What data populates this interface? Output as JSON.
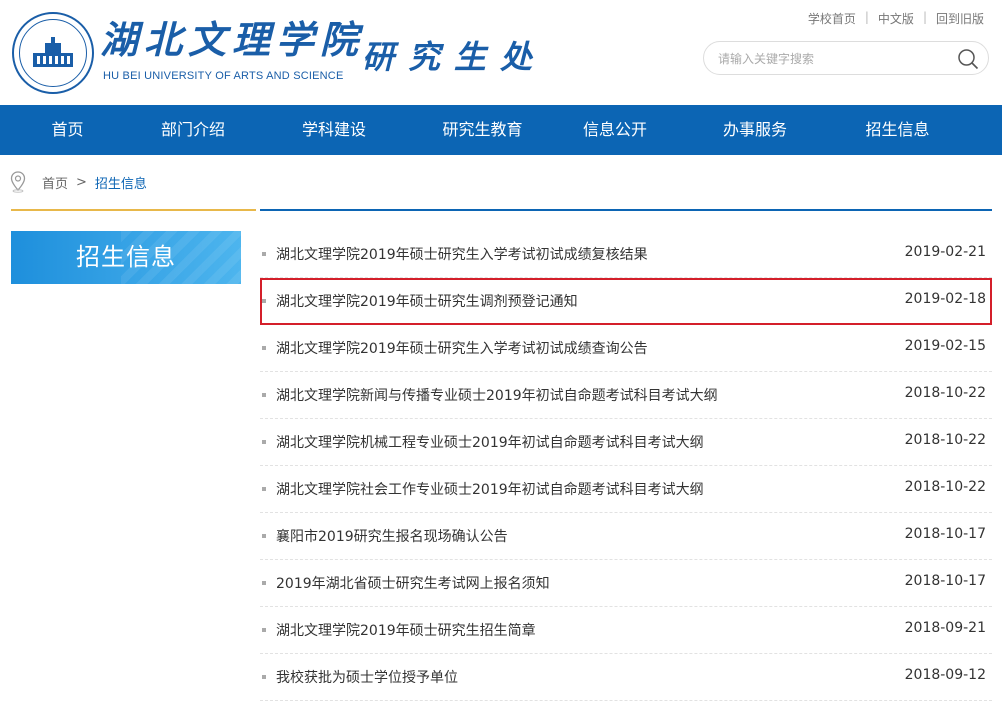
{
  "header": {
    "school_name": "湖北文理学院",
    "school_name_en": "HU BEI UNIVERSITY OF ARTS AND SCIENCE",
    "dept_name": "研究生处",
    "top_links": [
      "学校首页",
      "中文版",
      "回到旧版"
    ],
    "search_placeholder": "请输入关键字搜索",
    "brand_color": "#0c65b4"
  },
  "nav": {
    "items": [
      "首页",
      "部门介绍",
      "学科建设",
      "研究生教育",
      "信息公开",
      "办事服务",
      "招生信息"
    ]
  },
  "breadcrumb": {
    "home": "首页",
    "separator": ">",
    "current": "招生信息"
  },
  "sidebar": {
    "title": "招生信息"
  },
  "news": {
    "highlight_color": "#d41f2a",
    "items": [
      {
        "title": "湖北文理学院2019年硕士研究生入学考试初试成绩复核结果",
        "date": "2019-02-21",
        "highlighted": false
      },
      {
        "title": "湖北文理学院2019年硕士研究生调剂预登记通知",
        "date": "2019-02-18",
        "highlighted": true
      },
      {
        "title": "湖北文理学院2019年硕士研究生入学考试初试成绩查询公告",
        "date": "2019-02-15",
        "highlighted": false
      },
      {
        "title": "湖北文理学院新闻与传播专业硕士2019年初试自命题考试科目考试大纲",
        "date": "2018-10-22",
        "highlighted": false
      },
      {
        "title": "湖北文理学院机械工程专业硕士2019年初试自命题考试科目考试大纲",
        "date": "2018-10-22",
        "highlighted": false
      },
      {
        "title": "湖北文理学院社会工作专业硕士2019年初试自命题考试科目考试大纲",
        "date": "2018-10-22",
        "highlighted": false
      },
      {
        "title": "襄阳市2019研究生报名现场确认公告",
        "date": "2018-10-17",
        "highlighted": false
      },
      {
        "title": "2019年湖北省硕士研究生考试网上报名须知",
        "date": "2018-10-17",
        "highlighted": false
      },
      {
        "title": "湖北文理学院2019年硕士研究生招生简章",
        "date": "2018-09-21",
        "highlighted": false
      },
      {
        "title": "我校获批为硕士学位授予单位",
        "date": "2018-09-12",
        "highlighted": false
      }
    ]
  }
}
